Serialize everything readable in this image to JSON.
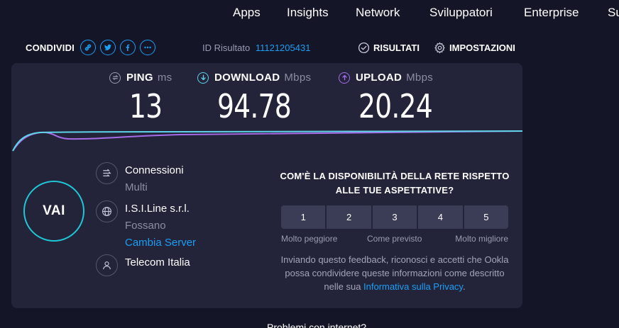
{
  "nav": {
    "items": [
      "Apps",
      "Insights",
      "Network",
      "Sviluppatori",
      "Enterprise",
      "Su"
    ]
  },
  "share": {
    "label": "CONDIVIDI",
    "icons": [
      "link-icon",
      "twitter-icon",
      "facebook-icon",
      "more-icon"
    ]
  },
  "result": {
    "id_label": "ID Risultato",
    "id_value": "11121205431"
  },
  "actions": {
    "results_label": "RISULTATI",
    "settings_label": "IMPOSTAZIONI"
  },
  "metrics": {
    "ping": {
      "label": "PING",
      "unit": "ms",
      "value": "13"
    },
    "download": {
      "label": "DOWNLOAD",
      "unit": "Mbps",
      "value": "94.78"
    },
    "upload": {
      "label": "UPLOAD",
      "unit": "Mbps",
      "value": "20.24"
    }
  },
  "colors": {
    "accent": "#1b9ff5",
    "go_ring": "#1fc7d6",
    "download_line": "#5fd3e8",
    "upload_line": "#a66ce8",
    "panel_bg": "#23243a",
    "page_bg": "#141526"
  },
  "go_button": {
    "label": "VAI"
  },
  "connection": {
    "connections_label": "Connessioni",
    "connections_value": "Multi",
    "server_name": "I.S.I.Line s.r.l.",
    "server_location": "Fossano",
    "change_server": "Cambia Server",
    "isp": "Telecom Italia"
  },
  "feedback": {
    "question": "COM'È LA DISPONIBILITÀ DELLA RETE RISPETTO ALLE TUE ASPETTATIVE?",
    "options": [
      "1",
      "2",
      "3",
      "4",
      "5"
    ],
    "low_label": "Molto peggiore",
    "mid_label": "Come previsto",
    "high_label": "Molto migliore",
    "disclaimer_text": "Inviando questo feedback, riconosci e accetti che Ookla possa condividere queste informazioni come descritto nelle sua ",
    "privacy_link": "Informativa sulla Privacy",
    "disclaimer_end": "."
  },
  "footer": {
    "problems": "Problemi con internet?"
  }
}
